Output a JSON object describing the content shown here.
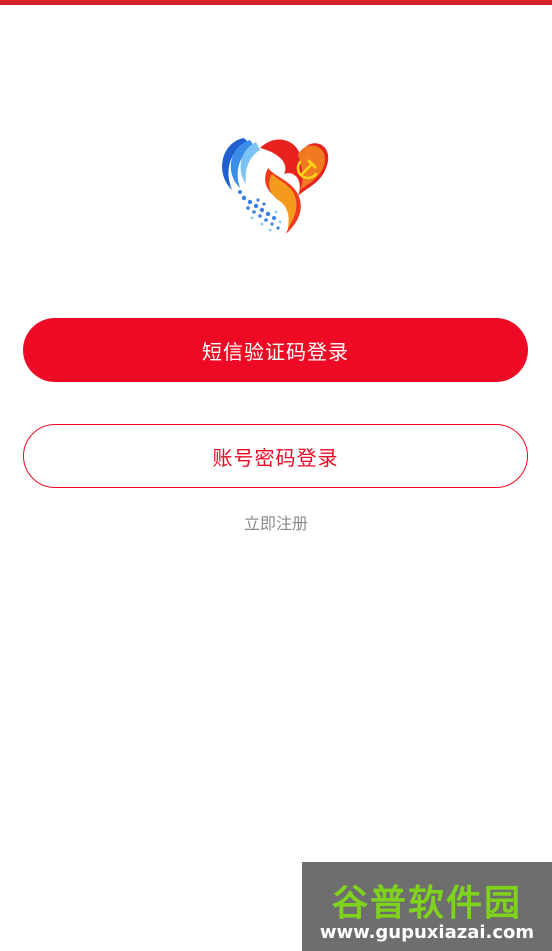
{
  "theme": {
    "primary": "#ee0a24",
    "top_bar": "#d32227"
  },
  "logo": {
    "icon": "heart-party-emblem-icon"
  },
  "buttons": {
    "sms_login": "短信验证码登录",
    "account_login": "账号密码登录"
  },
  "links": {
    "register": "立即注册"
  },
  "watermark": {
    "title": "谷普软件园",
    "url": "www.gupuxiazai.com",
    "color": "#7fd31c"
  }
}
